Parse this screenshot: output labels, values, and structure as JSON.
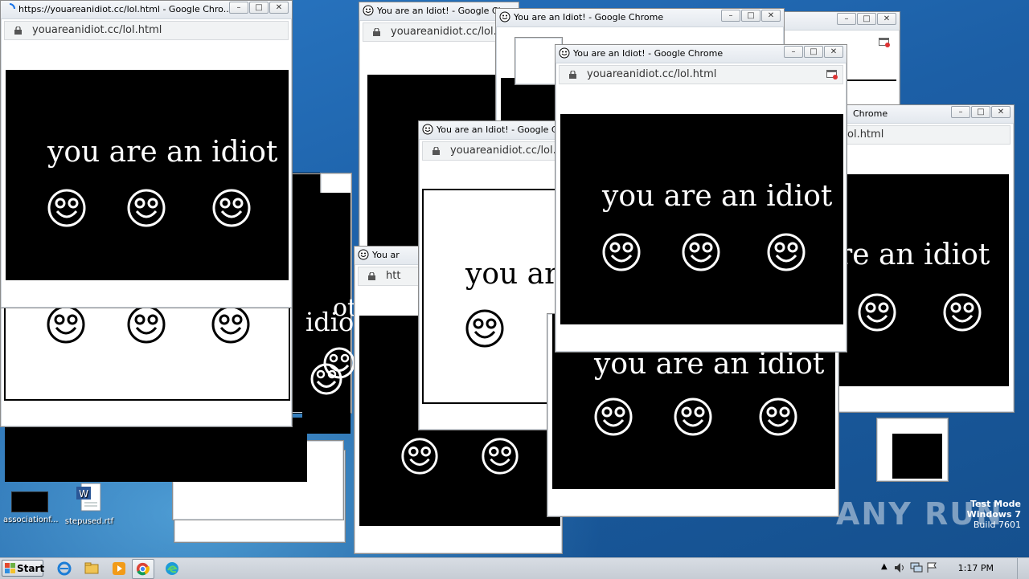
{
  "desktop": {
    "icons": [
      {
        "label": "associationf..."
      },
      {
        "label": "stepused.rtf"
      }
    ],
    "watermark": {
      "line1": "Test Mode",
      "line2": "Windows 7",
      "line3": "Build 7601"
    },
    "anyrun_logo": "ANY RUN"
  },
  "popup": {
    "window_title": "You are an Idiot! - Google Chrome",
    "window_title_loading": "https://youareanidiot.cc/lol.html - Google Chro...",
    "window_title_truncated": "You are an Idiot! - Google Chro",
    "window_title_short": "You ar",
    "window_title_partial": "Chrome",
    "url": "youareanidiot.cc/lol.html",
    "url_truncated": "youareanidiot.cc/lol.ht",
    "url_partial": "ol.html",
    "url_short": "htt",
    "message": "you are an idiot",
    "message_partial_1": "you ar",
    "message_partial_2": "re an idiot",
    "message_partial_3": "idio",
    "message_partial_4": "ot",
    "controls": {
      "minimize": "–",
      "maximize": "□",
      "close": "✕"
    }
  },
  "taskbar": {
    "start_label": "Start",
    "clock": "1:17 PM",
    "pinned": [
      "internet-explorer-icon",
      "explorer-icon",
      "media-player-icon",
      "chrome-icon",
      "edge-icon"
    ]
  },
  "colors": {
    "desktop": "#1c5fa6",
    "popup_bg": "#000000",
    "popup_text": "#ffffff"
  }
}
